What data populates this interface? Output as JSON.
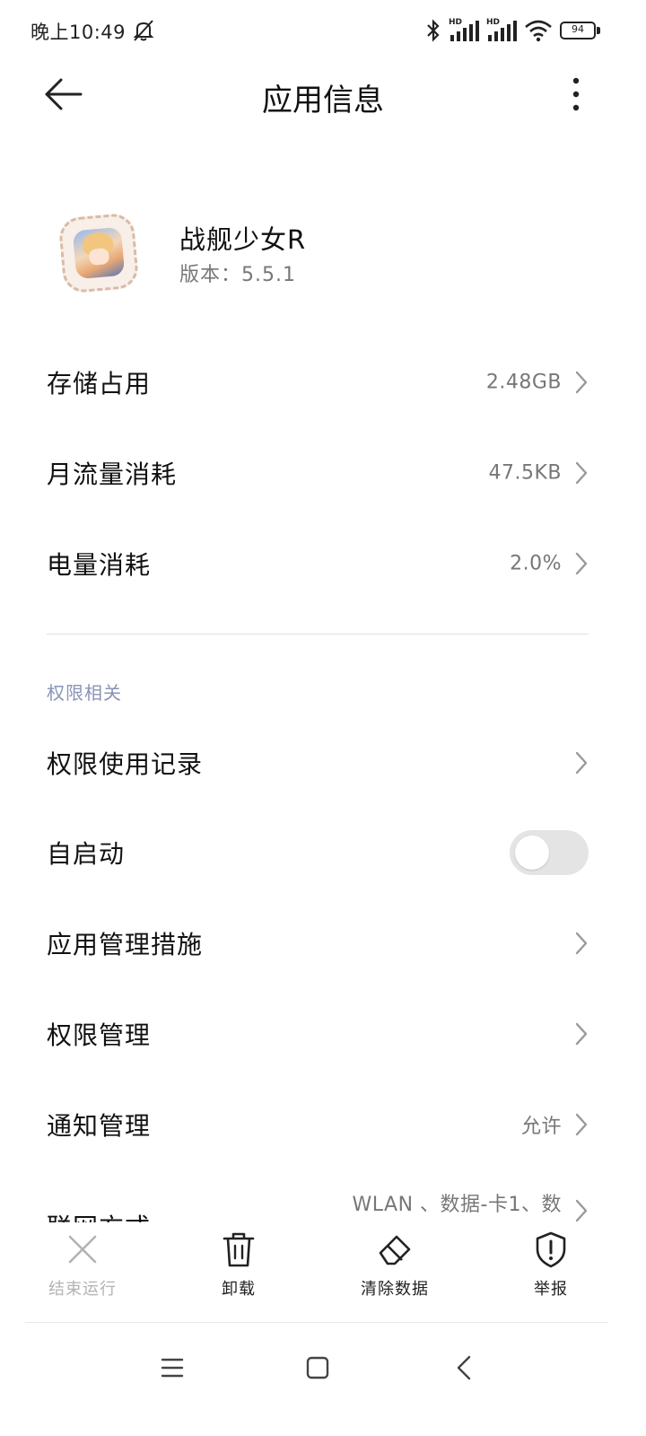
{
  "status_bar": {
    "time": "晚上10:49",
    "battery_level": "94",
    "signal_badges": [
      "HD",
      "HD"
    ]
  },
  "header": {
    "title": "应用信息"
  },
  "app": {
    "name": "战舰少女R",
    "version": "版本：5.5.1"
  },
  "usage_rows": [
    {
      "label": "存储占用",
      "value": "2.48GB"
    },
    {
      "label": "月流量消耗",
      "value": "47.5KB"
    },
    {
      "label": "电量消耗",
      "value": "2.0%"
    }
  ],
  "permissions_section": {
    "header": "权限相关",
    "rows": [
      {
        "label": "权限使用记录",
        "value": ""
      },
      {
        "label": "自启动",
        "toggle_on": false
      },
      {
        "label": "应用管理措施",
        "value": ""
      },
      {
        "label": "权限管理",
        "value": ""
      },
      {
        "label": "通知管理",
        "value": "允许"
      },
      {
        "label": "联网方式",
        "value": "WLAN 、数据-卡1、数"
      }
    ]
  },
  "actions": [
    {
      "label": "结束运行",
      "icon": "close-icon",
      "enabled": false
    },
    {
      "label": "卸载",
      "icon": "trash-icon",
      "enabled": true
    },
    {
      "label": "清除数据",
      "icon": "eraser-icon",
      "enabled": true
    },
    {
      "label": "举报",
      "icon": "shield-alert-icon",
      "enabled": true
    }
  ],
  "colors": {
    "section_header": "#8a94b6",
    "secondary_text": "#777777",
    "toggle_off": "#e4e4e4",
    "disabled_text": "#b3b3b3"
  }
}
